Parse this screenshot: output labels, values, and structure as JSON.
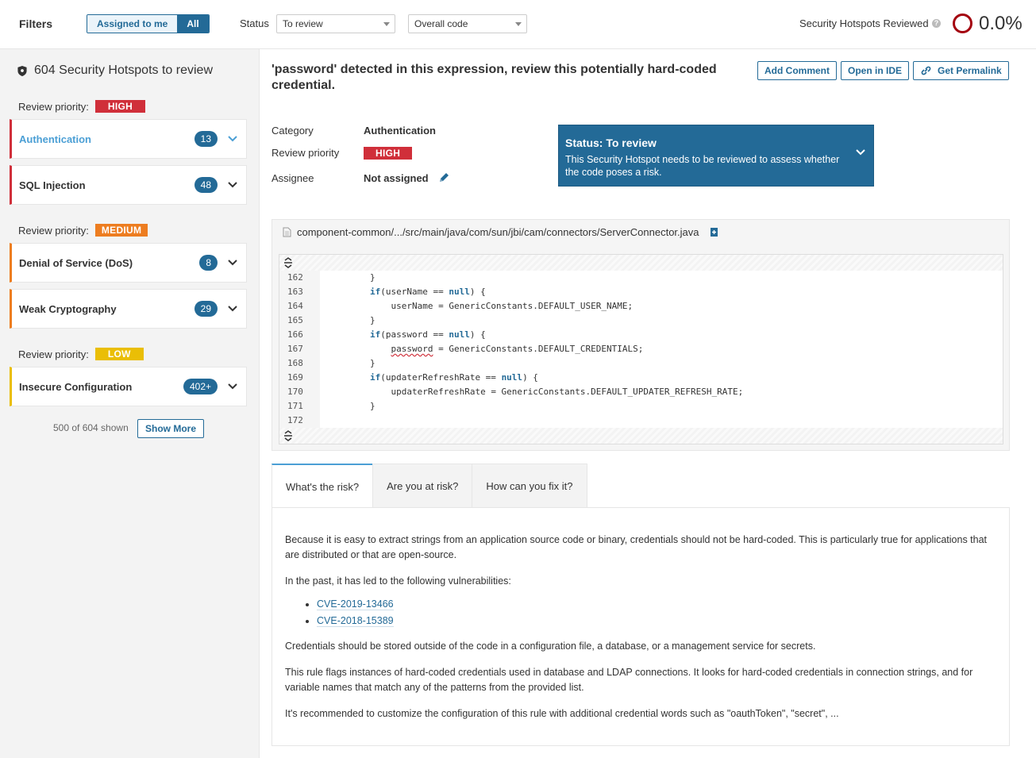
{
  "topbar": {
    "filters_title": "Filters",
    "toggle": {
      "assigned": "Assigned to me",
      "all": "All"
    },
    "status_label": "Status",
    "status_select": "To review",
    "scope_select": "Overall code",
    "reviewed_label": "Security Hotspots Reviewed",
    "reviewed_pct": "0.0%"
  },
  "sidebar": {
    "header": "604 Security Hotspots to review",
    "review_priority_label": "Review priority:",
    "groups": [
      {
        "priority": "HIGH",
        "color": "#d02f3a",
        "categories": [
          {
            "name": "Authentication",
            "count": "13",
            "color": "#d02f3a",
            "active": true
          },
          {
            "name": "SQL Injection",
            "count": "48",
            "color": "#d02f3a"
          }
        ]
      },
      {
        "priority": "MEDIUM",
        "color": "#ed7d20",
        "categories": [
          {
            "name": "Denial of Service (DoS)",
            "count": "8",
            "color": "#ed7d20"
          },
          {
            "name": "Weak Cryptography",
            "count": "29",
            "color": "#ed7d20"
          }
        ]
      },
      {
        "priority": "LOW",
        "color": "#eabe06",
        "categories": [
          {
            "name": "Insecure Configuration",
            "count": "402+",
            "color": "#eabe06"
          }
        ]
      }
    ],
    "shown": "500 of 604 shown",
    "show_more": "Show More"
  },
  "hotspot": {
    "title": "'password' detected in this expression, review this potentially hard-coded credential.",
    "buttons": {
      "add_comment": "Add Comment",
      "open_ide": "Open in IDE",
      "permalink": "Get Permalink"
    },
    "category_label": "Category",
    "category": "Authentication",
    "priority_label": "Review priority",
    "priority": "HIGH",
    "assignee_label": "Assignee",
    "assignee": "Not assigned",
    "status_title": "Status: To review",
    "status_desc": "This Security Hotspot needs to be reviewed to assess whether the code poses a risk."
  },
  "code": {
    "file": "component-common/.../src/main/java/com/sun/jbi/cam/connectors/ServerConnector.java",
    "lines": [
      {
        "n": "162",
        "indent": "        ",
        "parts": [
          [
            "t",
            "}"
          ]
        ]
      },
      {
        "n": "163",
        "indent": "        ",
        "parts": [
          [
            "k",
            "if"
          ],
          [
            "t",
            "(userName == "
          ],
          [
            "k",
            "null"
          ],
          [
            "t",
            ") {"
          ]
        ]
      },
      {
        "n": "164",
        "indent": "            ",
        "parts": [
          [
            "t",
            "userName = GenericConstants.DEFAULT_USER_NAME;"
          ]
        ]
      },
      {
        "n": "165",
        "indent": "        ",
        "parts": [
          [
            "t",
            "}"
          ]
        ]
      },
      {
        "n": "166",
        "indent": "        ",
        "parts": [
          [
            "k",
            "if"
          ],
          [
            "t",
            "(password == "
          ],
          [
            "k",
            "null"
          ],
          [
            "t",
            ") {"
          ]
        ]
      },
      {
        "n": "167",
        "indent": "            ",
        "parts": [
          [
            "s",
            "password"
          ],
          [
            "t",
            " = GenericConstants.DEFAULT_CREDENTIALS;"
          ]
        ]
      },
      {
        "n": "168",
        "indent": "        ",
        "parts": [
          [
            "t",
            "}"
          ]
        ]
      },
      {
        "n": "169",
        "indent": "        ",
        "parts": [
          [
            "k",
            "if"
          ],
          [
            "t",
            "(updaterRefreshRate == "
          ],
          [
            "k",
            "null"
          ],
          [
            "t",
            ") {"
          ]
        ]
      },
      {
        "n": "170",
        "indent": "            ",
        "parts": [
          [
            "t",
            "updaterRefreshRate = GenericConstants.DEFAULT_UPDATER_REFRESH_RATE;"
          ]
        ]
      },
      {
        "n": "171",
        "indent": "        ",
        "parts": [
          [
            "t",
            "}"
          ]
        ]
      },
      {
        "n": "172",
        "indent": "",
        "parts": [
          [
            "t",
            ""
          ]
        ]
      }
    ]
  },
  "tabs": {
    "risk": "What's the risk?",
    "at_risk": "Are you at risk?",
    "fix": "How can you fix it?"
  },
  "risk": {
    "p1": "Because it is easy to extract strings from an application source code or binary, credentials should not be hard-coded. This is particularly true for applications that are distributed or that are open-source.",
    "p2": "In the past, it has led to the following vulnerabilities:",
    "cves": [
      "CVE-2019-13466",
      "CVE-2018-15389"
    ],
    "p3": "Credentials should be stored outside of the code in a configuration file, a database, or a management service for secrets.",
    "p4": "This rule flags instances of hard-coded credentials used in database and LDAP connections. It looks for hard-coded credentials in connection strings, and for variable names that match any of the patterns from the provided list.",
    "p5": "It's recommended to customize the configuration of this rule with additional credential words such as \"oauthToken\", \"secret\", ..."
  }
}
